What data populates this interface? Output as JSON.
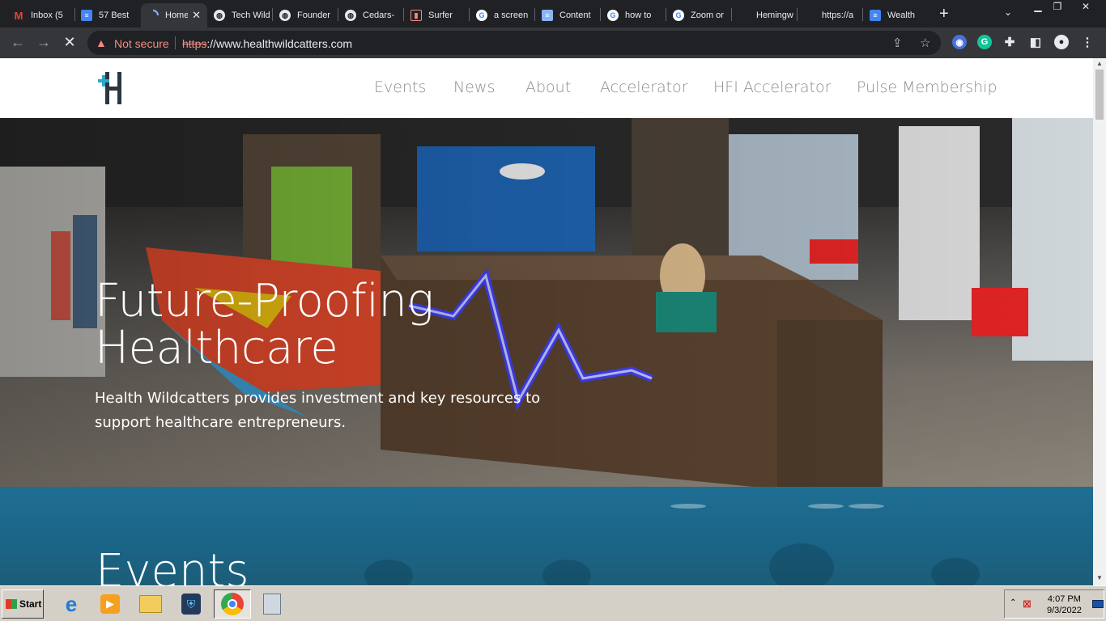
{
  "browser": {
    "tabs": [
      {
        "label": "Inbox (5",
        "icon": "gmail-icon",
        "active": false
      },
      {
        "label": "57 Best",
        "icon": "docs-icon",
        "active": false
      },
      {
        "label": "Home",
        "icon": "loading-icon",
        "active": true
      },
      {
        "label": "Tech Wild",
        "icon": "globe-icon",
        "active": false
      },
      {
        "label": "Founder",
        "icon": "globe-icon",
        "active": false
      },
      {
        "label": "Cedars-",
        "icon": "globe-icon",
        "active": false
      },
      {
        "label": "Surfer",
        "icon": "surfer-icon",
        "active": false
      },
      {
        "label": "a screen",
        "icon": "google-icon",
        "active": false
      },
      {
        "label": "Content",
        "icon": "docs-icon",
        "active": false
      },
      {
        "label": "how to",
        "icon": "google-icon",
        "active": false
      },
      {
        "label": "Zoom or",
        "icon": "google-icon",
        "active": false
      },
      {
        "label": "Hemingw",
        "icon": "blank-icon",
        "active": false
      },
      {
        "label": "https://a",
        "icon": "blank-icon",
        "active": false
      },
      {
        "label": "Wealth",
        "icon": "docs-icon",
        "active": false
      }
    ],
    "security_label": "Not secure",
    "url_scheme": "https",
    "url_rest": "://www.healthwildcatters.com"
  },
  "site": {
    "nav": [
      "Events",
      "News",
      "About",
      "Accelerator",
      "HFI Accelerator",
      "Pulse Membership"
    ],
    "hero_title_line1": "Future-Proofing",
    "hero_title_line2": "Healthcare",
    "hero_subtitle": "Health Wildcatters provides investment and key resources to support healthcare entrepreneurs.",
    "events_heading": "Events",
    "accent_color": "#1f6e93"
  },
  "taskbar": {
    "start_label": "Start",
    "time": "4:07 PM",
    "date": "9/3/2022"
  }
}
